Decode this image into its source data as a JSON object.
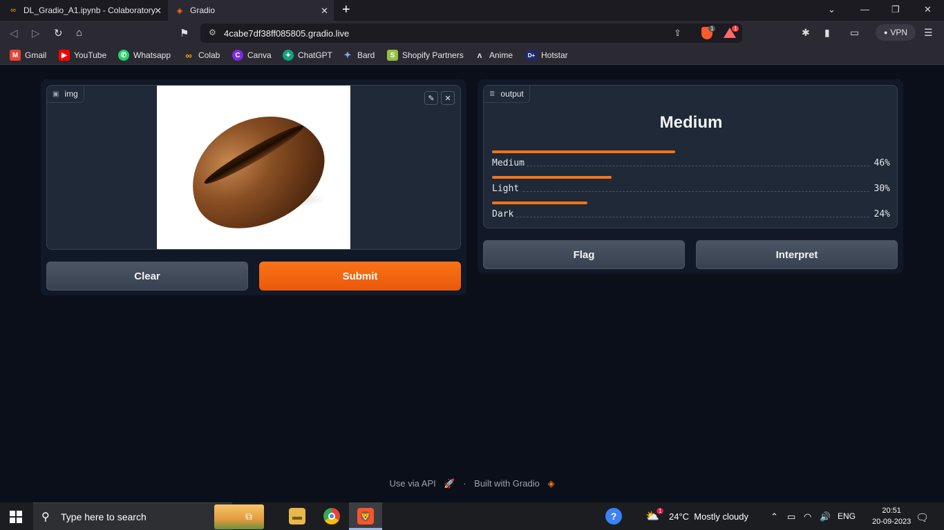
{
  "browser": {
    "tabs": [
      {
        "title": "DL_Gradio_A1.ipynb - Colaboratory",
        "icon": "colab-icon",
        "active": false
      },
      {
        "title": "Gradio",
        "icon": "gradio-icon",
        "active": true
      }
    ],
    "url": "4cabe7df38ff085805.gradio.live",
    "shield_badge": "1",
    "alert_badge": "1",
    "vpn_label": "VPN",
    "bookmarks": [
      {
        "label": "Gmail",
        "icon": "gmail-icon",
        "color": "#ea4335"
      },
      {
        "label": "YouTube",
        "icon": "youtube-icon",
        "color": "#ff0000"
      },
      {
        "label": "Whatsapp",
        "icon": "whatsapp-icon",
        "color": "#25d366"
      },
      {
        "label": "Colab",
        "icon": "colab-icon",
        "color": "#f9ab00"
      },
      {
        "label": "Canva",
        "icon": "canva-icon",
        "color": "#7d2ae8"
      },
      {
        "label": "ChatGPT",
        "icon": "chatgpt-icon",
        "color": "#10a37f"
      },
      {
        "label": "Bard",
        "icon": "bard-icon",
        "color": "#4285f4"
      },
      {
        "label": "Shopify Partners",
        "icon": "shopify-icon",
        "color": "#95bf47"
      },
      {
        "label": "Anime",
        "icon": "anime-icon",
        "color": "#888888"
      },
      {
        "label": "Hotstar",
        "icon": "hotstar-icon",
        "color": "#1f2a6b"
      }
    ]
  },
  "app": {
    "input_label": "img",
    "output_label": "output",
    "clear_label": "Clear",
    "submit_label": "Submit",
    "flag_label": "Flag",
    "interpret_label": "Interpret",
    "prediction": "Medium",
    "confidences": [
      {
        "label": "Medium",
        "value": "46%",
        "fraction": 0.46
      },
      {
        "label": "Light",
        "value": "30%",
        "fraction": 0.3
      },
      {
        "label": "Dark",
        "value": "24%",
        "fraction": 0.24
      }
    ],
    "accent_color": "#f97316",
    "footer": {
      "api_label": "Use via API",
      "separator": "·",
      "built_label": "Built with Gradio"
    }
  },
  "taskbar": {
    "search_placeholder": "Type here to search",
    "weather": "24°C  Mostly cloudy",
    "weather_badge": "1",
    "language": "ENG",
    "time": "20:51",
    "date": "20-09-2023"
  }
}
